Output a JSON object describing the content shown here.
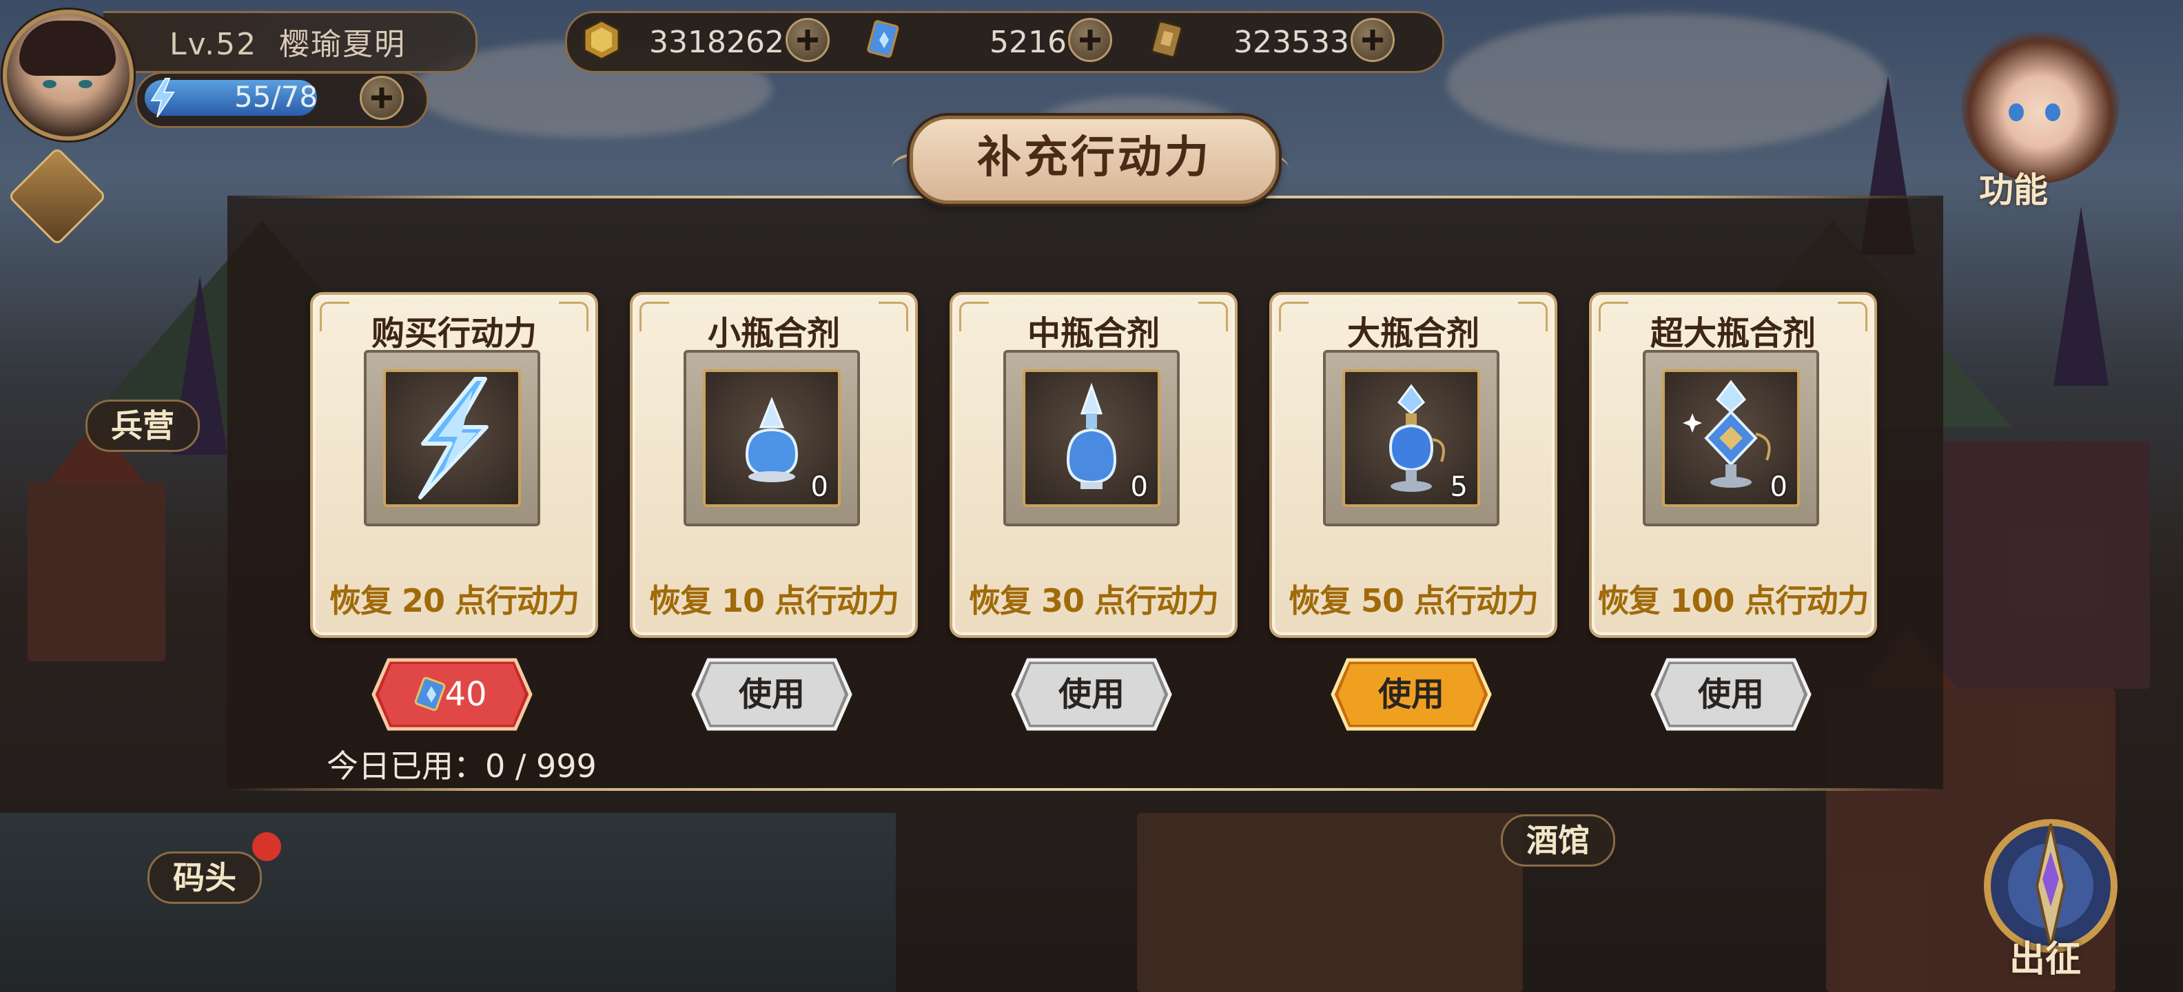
{
  "player": {
    "level": "Lv.52",
    "name": "樱瑜夏明",
    "energy": "55/78"
  },
  "resources": [
    {
      "icon": "gold-coin-icon",
      "value": "3318262"
    },
    {
      "icon": "blue-gem-ticket-icon",
      "value": "5216"
    },
    {
      "icon": "bronze-token-icon",
      "value": "323533"
    }
  ],
  "map": {
    "barracks": "兵营",
    "dock": "码头",
    "tavern": "酒馆"
  },
  "side": {
    "function_label": "功能",
    "expedition_label": "出征"
  },
  "dialog": {
    "title": "补充行动力",
    "used_today_label": "今日已用：0 / 999"
  },
  "cards": [
    {
      "title": "购买行动力",
      "desc": "恢复 20 点行动力",
      "count": "",
      "button": "40",
      "button_style": "red-cost",
      "icon": "lightning-bolt-icon"
    },
    {
      "title": "小瓶合剂",
      "desc": "恢复 10 点行动力",
      "count": "0",
      "button": "使用",
      "button_style": "silver",
      "icon": "small-potion-icon"
    },
    {
      "title": "中瓶合剂",
      "desc": "恢复 30 点行动力",
      "count": "0",
      "button": "使用",
      "button_style": "silver",
      "icon": "medium-potion-icon"
    },
    {
      "title": "大瓶合剂",
      "desc": "恢复 50 点行动力",
      "count": "5",
      "button": "使用",
      "button_style": "gold",
      "icon": "large-potion-icon"
    },
    {
      "title": "超大瓶合剂",
      "desc": "恢复 100 点行动力",
      "count": "0",
      "button": "使用",
      "button_style": "silver",
      "icon": "extra-large-potion-icon"
    }
  ],
  "colors": {
    "desc_text": "#a06a0a",
    "gold_button": "#f0a020",
    "red_button": "#d83a3a"
  }
}
